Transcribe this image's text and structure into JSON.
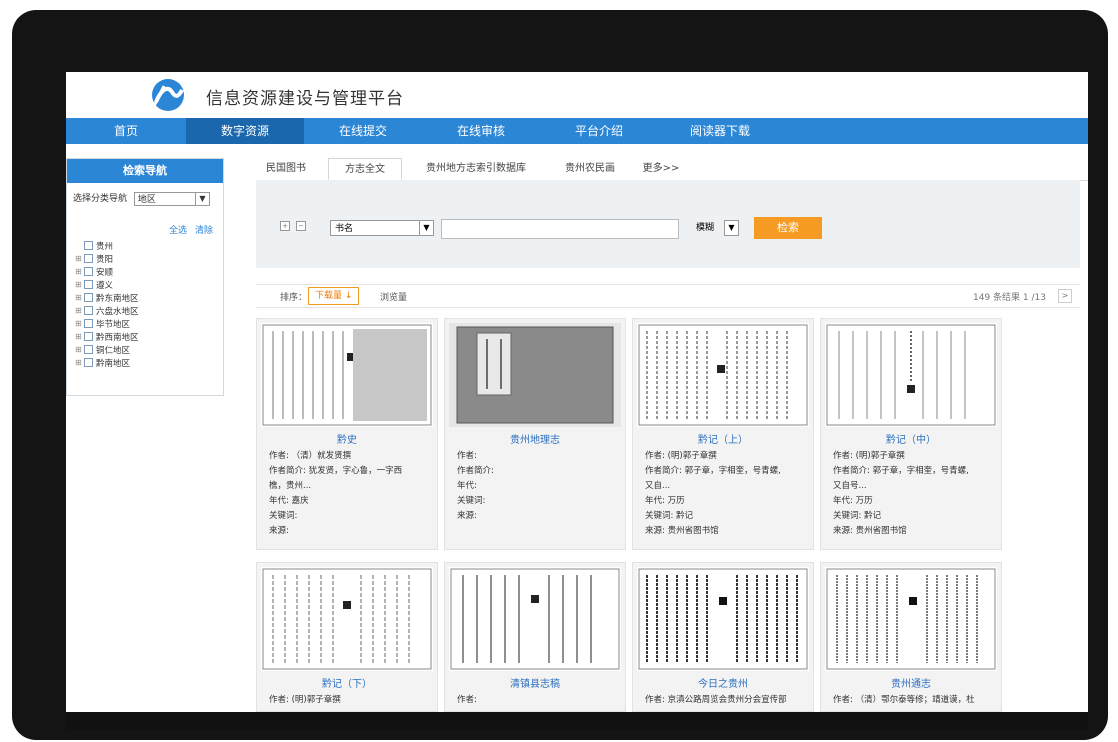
{
  "site": {
    "title": "信息资源建设与管理平台"
  },
  "nav": [
    {
      "label": "首页",
      "active": false
    },
    {
      "label": "数字资源",
      "active": true
    },
    {
      "label": "在线提交",
      "active": false
    },
    {
      "label": "在线审核",
      "active": false
    },
    {
      "label": "平台介绍",
      "active": false
    },
    {
      "label": "阅读器下载",
      "active": false
    }
  ],
  "sidebar": {
    "title": "检索导航",
    "select_label": "选择分类导航",
    "select_value": "地区",
    "select_all": "全选",
    "clear": "清除",
    "tree": [
      "贵州",
      "贵阳",
      "安顺",
      "遵义",
      "黔东南地区",
      "六盘水地区",
      "毕节地区",
      "黔西南地区",
      "铜仁地区",
      "黔南地区"
    ]
  },
  "tabs": [
    {
      "label": "民国图书",
      "active": false
    },
    {
      "label": "方志全文",
      "active": true
    },
    {
      "label": "贵州地方志索引数据库",
      "active": false
    },
    {
      "label": "贵州农民画",
      "active": false
    },
    {
      "label": "更多>>",
      "active": false
    }
  ],
  "search": {
    "field": "书名",
    "keyword": "",
    "mode": "模糊",
    "button": "检索"
  },
  "sort": {
    "label": "排序：",
    "download": "下载量",
    "browse": "浏览量",
    "count": "149 条结果 1 /13",
    "next": ">"
  },
  "cards": [
    {
      "title": "黔史",
      "lines": [
        "作者: （清）就发贤撰",
        "作者简介: 犹发贤，字心鲁，一字西",
        "樵，贵州...",
        "年代: 嘉庆",
        "关键词:",
        "来源:"
      ]
    },
    {
      "title": "贵州地理志",
      "lines": [
        "作者:",
        "作者简介:",
        "年代:",
        "关键词:",
        "来源:"
      ]
    },
    {
      "title": "黔记（上）",
      "lines": [
        "作者: (明)郭子章撰",
        "作者简介: 郭子章，字相奎，号青螺,",
        "又自...",
        "年代: 万历",
        "关键词: 黔记",
        "来源: 贵州省图书馆"
      ]
    },
    {
      "title": "黔记（中）",
      "lines": [
        "作者: (明)郭子章撰",
        "作者简介: 郭子章，字相奎，号青螺,",
        "又自号...",
        "年代: 万历",
        "关键词: 黔记",
        "来源: 贵州省图书馆"
      ]
    },
    {
      "title": "黔记（下）",
      "lines": [
        "作者: (明)郭子章撰"
      ]
    },
    {
      "title": "清镇县志稿",
      "lines": [
        "作者:"
      ]
    },
    {
      "title": "今日之贵州",
      "lines": [
        "作者: 京滇公路周览会贵州分会宣传部"
      ]
    },
    {
      "title": "贵州通志",
      "lines": [
        "作者: （清）鄂尔泰等修；靖道谟，杜"
      ]
    }
  ],
  "colors": {
    "nav_blue": "#2c86d6",
    "nav_active": "#1b67ad",
    "accent_orange": "#f59a23",
    "link_blue": "#2c6fbf"
  }
}
